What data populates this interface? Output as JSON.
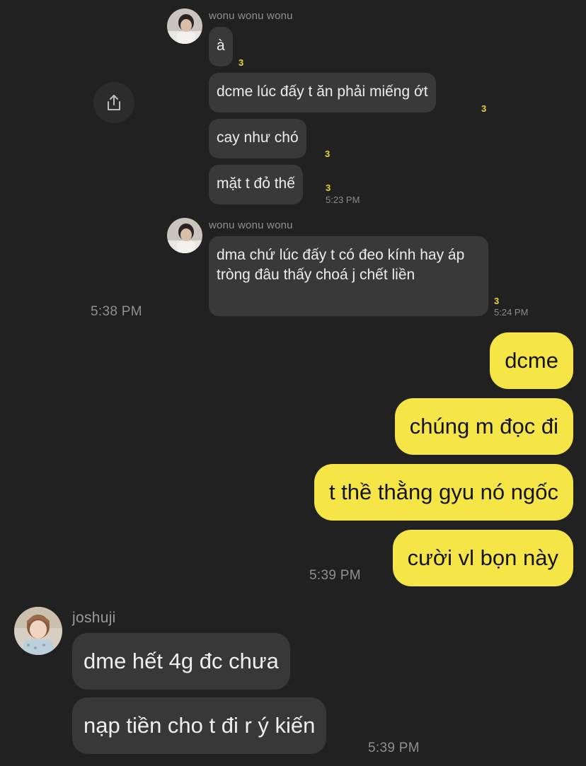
{
  "inner": {
    "sender_name": "wonu wonu wonu",
    "group1": [
      {
        "text": "à",
        "unread": "3"
      },
      {
        "text": "dcme lúc đấy t ăn phải miếng ớt",
        "unread": "3"
      },
      {
        "text": "cay như chó",
        "unread": "3"
      },
      {
        "text": "mặt t đỏ thế",
        "unread": "3"
      }
    ],
    "group1_time": "5:23 PM",
    "group2_sender_name": "wonu wonu wonu",
    "group2": [
      {
        "text": "dma chứ lúc đấy t có đeo kính hay áp tròng đâu thấy choá j chết liền",
        "unread": "3"
      }
    ],
    "group2_time": "5:24 PM"
  },
  "share_icon": "share-icon",
  "forward_time": "5:38 PM",
  "outgoing": {
    "messages": [
      "dcme",
      "chúng m đọc đi",
      "t thề thằng gyu nó ngốc",
      "cười vl bọn này"
    ],
    "time": "5:39 PM"
  },
  "incoming": {
    "sender_name": "joshuji",
    "messages": [
      "dme hết 4g đc chưa",
      "nạp tiền cho t đi r ý kiến"
    ],
    "time": "5:39 PM"
  },
  "colors": {
    "background": "#212121",
    "outgoing_bubble": "#f6e546",
    "incoming_bubble": "#383838",
    "unread": "#e9d532"
  }
}
